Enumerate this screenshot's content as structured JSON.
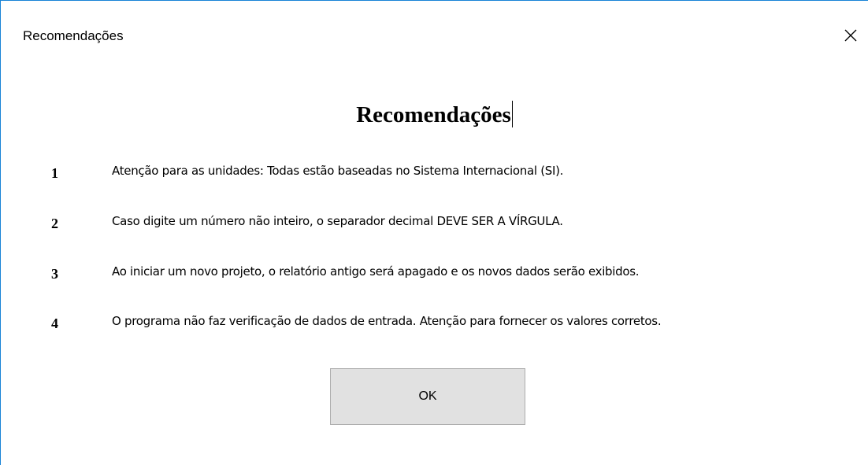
{
  "window": {
    "title": "Recomendações"
  },
  "content": {
    "heading": "Recomendações",
    "items": [
      {
        "number": "1",
        "text": "Atenção para as unidades: Todas estão baseadas no Sistema Internacional (SI)."
      },
      {
        "number": "2",
        "text": "Caso digite um número não inteiro, o separador decimal DEVE SER A VÍRGULA."
      },
      {
        "number": "3",
        "text": "Ao iniciar um novo projeto, o relatório antigo será apagado e os novos dados serão exibidos."
      },
      {
        "number": "4",
        "text": "O programa não faz verificação de dados de entrada. Atenção para fornecer os valores corretos."
      }
    ]
  },
  "buttons": {
    "ok_label": "OK"
  },
  "icons": {
    "close": "close-icon"
  },
  "colors": {
    "window_border": "#1883d7",
    "button_bg": "#e1e1e1",
    "button_border": "#adadad"
  }
}
